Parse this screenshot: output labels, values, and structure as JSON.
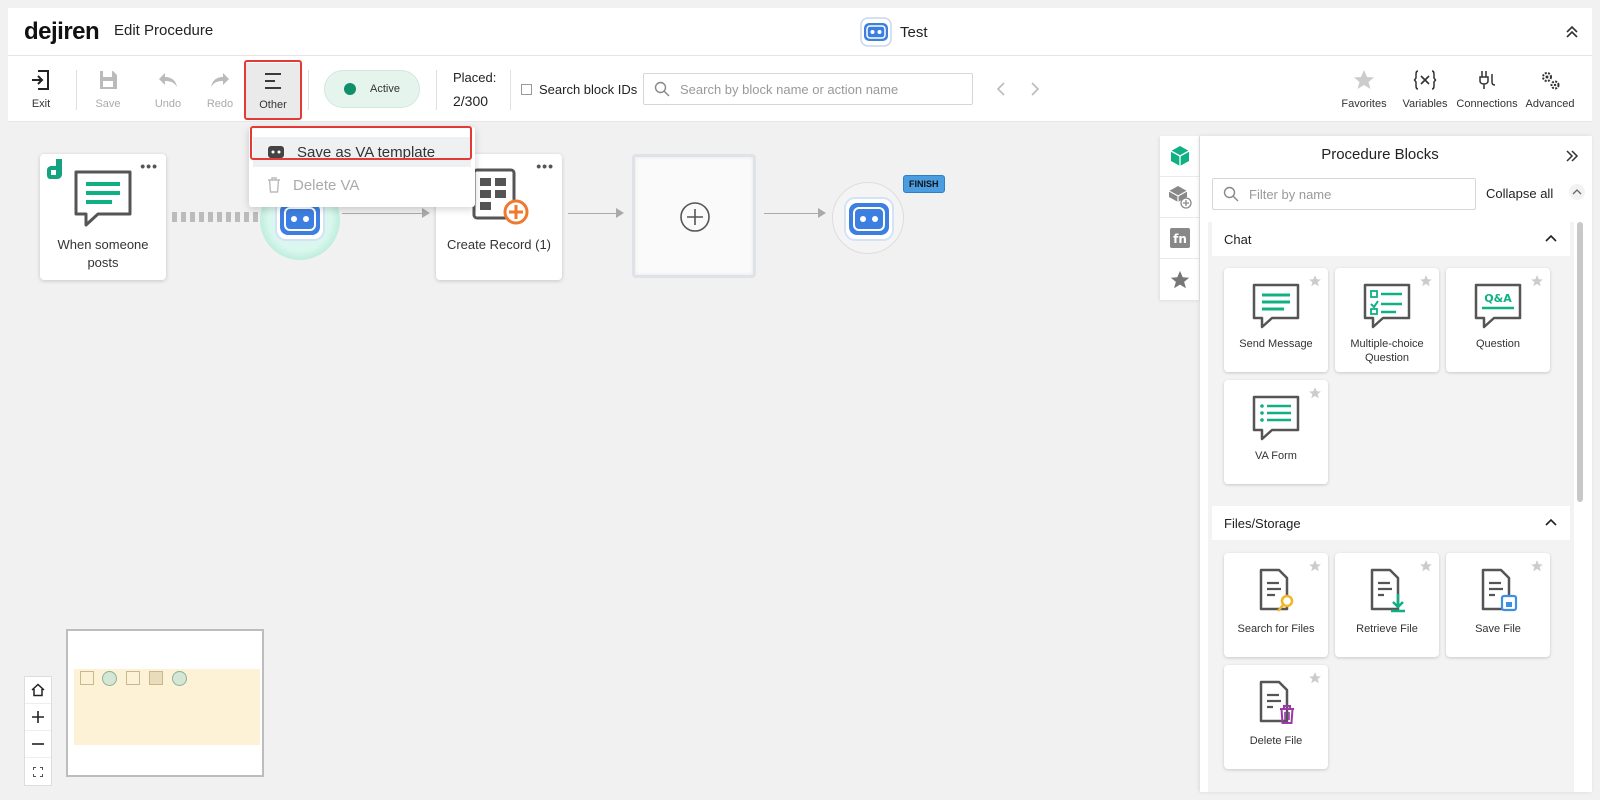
{
  "header": {
    "logo": "dejiren",
    "page_title": "Edit Procedure",
    "procedure_name": "Test"
  },
  "toolbar": {
    "exit": "Exit",
    "save": "Save",
    "undo": "Undo",
    "redo": "Redo",
    "other": "Other",
    "status": "Active",
    "placed_label": "Placed:",
    "placed_value": "2/300",
    "search_ids_label": "Search block IDs",
    "search_placeholder": "Search by block name or action name",
    "favorites": "Favorites",
    "variables": "Variables",
    "connections": "Connections",
    "advanced": "Advanced"
  },
  "dropdown": {
    "save_template": "Save as VA template",
    "delete_va": "Delete VA"
  },
  "canvas": {
    "trigger_label": "When someone posts",
    "create_record_label": "Create Record (1)",
    "finish_tag": "FINISH"
  },
  "panel": {
    "title": "Procedure Blocks",
    "filter_placeholder": "Filter by name",
    "collapse_all": "Collapse all",
    "categories": [
      {
        "name": "Chat",
        "blocks": [
          "Send Message",
          "Multiple-choice Question",
          "Question",
          "VA Form"
        ]
      },
      {
        "name": "Files/Storage",
        "blocks": [
          "Search for Files",
          "Retrieve File",
          "Save File",
          "Delete File"
        ]
      }
    ]
  },
  "colors": {
    "accent_green": "#10b085",
    "bot_blue": "#3d7fe0",
    "highlight_red": "#e53935"
  }
}
